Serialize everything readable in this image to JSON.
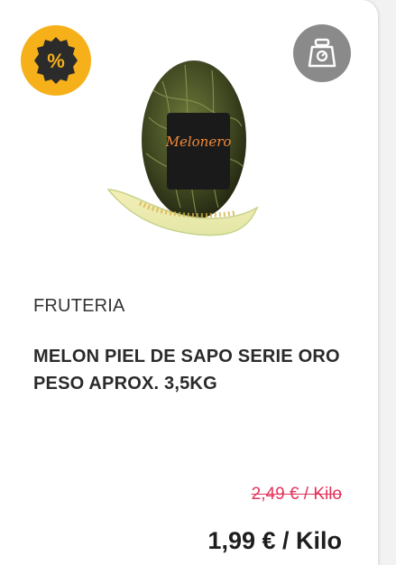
{
  "badge": {
    "icon": "percent-icon",
    "symbol": "%",
    "color": "#f5b01a"
  },
  "scale": {
    "icon": "scale-icon",
    "color": "#8a8a8a"
  },
  "product": {
    "image": "melon-piel-de-sapo-image",
    "category": "FRUTERIA",
    "name": "MELON PIEL DE SAPO SERIE ORO PESO APROX. 3,5KG",
    "old_price": "2,49 € / Kilo",
    "price": "1,99 € / Kilo"
  },
  "brand_label": {
    "text": "Melonero"
  },
  "colors": {
    "old_price": "#e4335a",
    "price": "#1e1e1e"
  }
}
